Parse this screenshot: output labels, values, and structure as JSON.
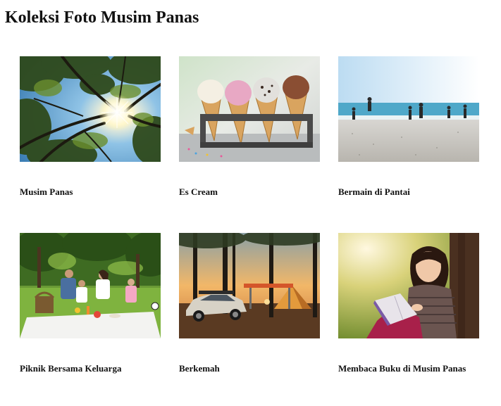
{
  "page": {
    "title": "Koleksi Foto Musim Panas"
  },
  "gallery": {
    "items": [
      {
        "caption": "Musim Panas"
      },
      {
        "caption": "Es Cream"
      },
      {
        "caption": "Bermain di Pantai"
      },
      {
        "caption": "Piknik Bersama Keluarga"
      },
      {
        "caption": "Berkemah"
      },
      {
        "caption": "Membaca Buku di Musim Panas"
      }
    ]
  }
}
